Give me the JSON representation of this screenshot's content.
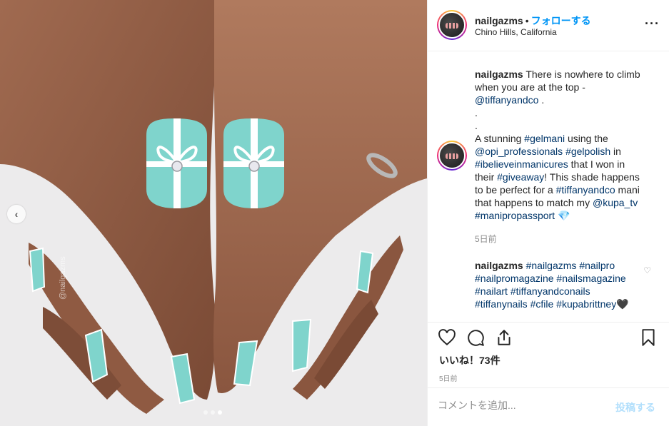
{
  "media": {
    "watermark": "@nailgazms",
    "carousel": {
      "total": 3,
      "active_index": 2
    },
    "prev_icon": "chevron-left-icon"
  },
  "header": {
    "username": "nailgazms",
    "separator": "•",
    "follow_label": "フォローする",
    "location": "Chino Hills, California",
    "more_icon": "ellipsis-icon"
  },
  "caption": {
    "username": "nailgazms",
    "text_before": "There is nowhere to climb when you are at the top -",
    "mention_tiffany": "@tiffanyandco",
    "dot_end": ".",
    "dot1": ".",
    "dot2": ".",
    "part_a": "A stunning",
    "tag_gelmani": "#gelmani",
    "part_b": "using the",
    "mention_opi": "@opi_professionals",
    "tag_gelpolish": "#gelpolish",
    "part_c": "in",
    "tag_ibelieve": "#ibelieveinmanicures",
    "part_d": "that I won in their",
    "tag_giveaway": "#giveaway",
    "part_e": "! This shade happens to be perfect for a",
    "tag_tiffanyandco": "#tiffanyandco",
    "part_f": "mani that happens to match my",
    "mention_kupa": "@kupa_tv",
    "tag_manipro": "#manipropassport",
    "emoji": "💎",
    "time_ago": "5日前"
  },
  "comment": {
    "username": "nailgazms",
    "tags": [
      "#nailgazms",
      "#nailpro",
      "#nailpromagazine",
      "#nailsmagazine",
      "#nailart",
      "#tiffanyandconails",
      "#tiffanynails",
      "#cfile",
      "#kupabrittney🖤"
    ]
  },
  "actions": {
    "like_icon": "heart-icon",
    "comment_icon": "comment-icon",
    "share_icon": "share-icon",
    "save_icon": "bookmark-icon",
    "likes_text": "いいね！73件",
    "date": "5日前"
  },
  "comment_bar": {
    "placeholder": "コメントを追加...",
    "post_label": "投稿する"
  },
  "colors": {
    "link": "#003569",
    "follow": "#0095f6",
    "nail_teal": "#7fd4cc"
  }
}
